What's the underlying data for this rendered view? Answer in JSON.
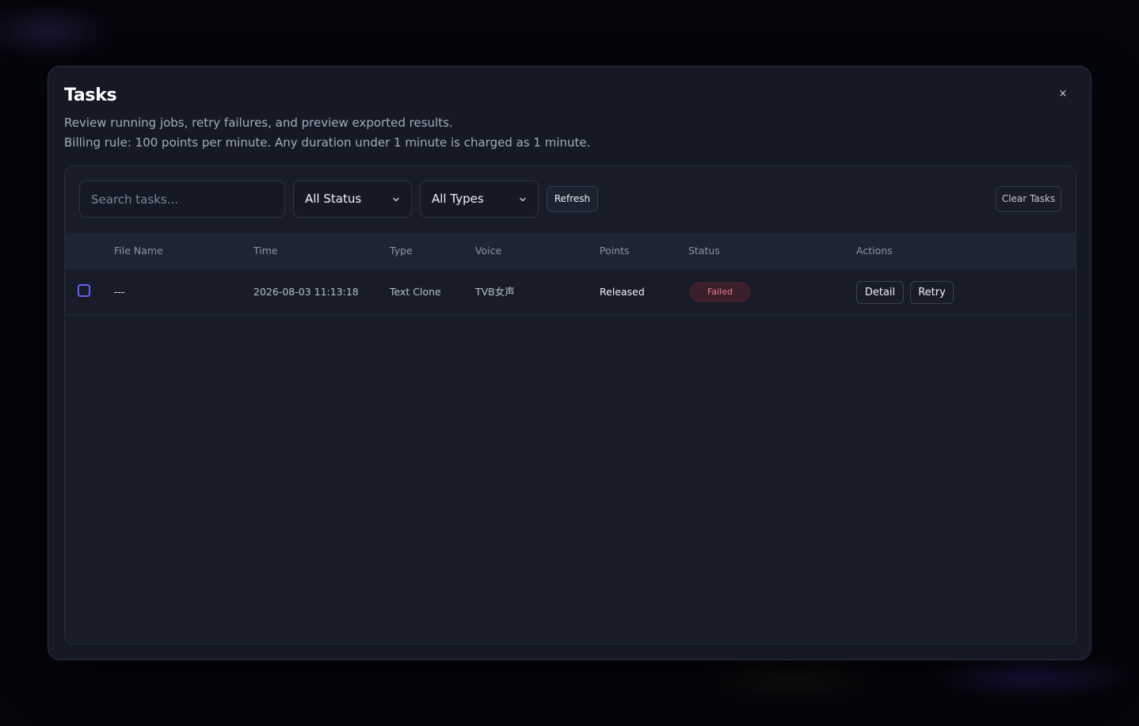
{
  "modal": {
    "title": "Tasks",
    "description_1": "Review running jobs, retry failures, and preview exported results.",
    "description_2": "Billing rule: 100 points per minute. Any duration under 1 minute is charged as 1 minute.",
    "close_label": "×"
  },
  "toolbar": {
    "search_placeholder": "Search tasks...",
    "status_filter": "All Status",
    "type_filter": "All Types",
    "refresh_label": "Refresh",
    "clear_label": "Clear Tasks"
  },
  "table": {
    "columns": [
      "File Name",
      "Time",
      "Type",
      "Voice",
      "Points",
      "Status",
      "Actions"
    ],
    "rows": [
      {
        "file_name": "---",
        "time": "2026-08-03 11:13:18",
        "type": "Text Clone",
        "voice": "TVB女声",
        "points": "Released",
        "status": "Failed",
        "actions": [
          "Detail",
          "Retry"
        ]
      }
    ]
  },
  "colors": {
    "accent": "#6b5cf0",
    "failed_text": "#f07a86",
    "failed_bg": "#3b1f2a"
  }
}
